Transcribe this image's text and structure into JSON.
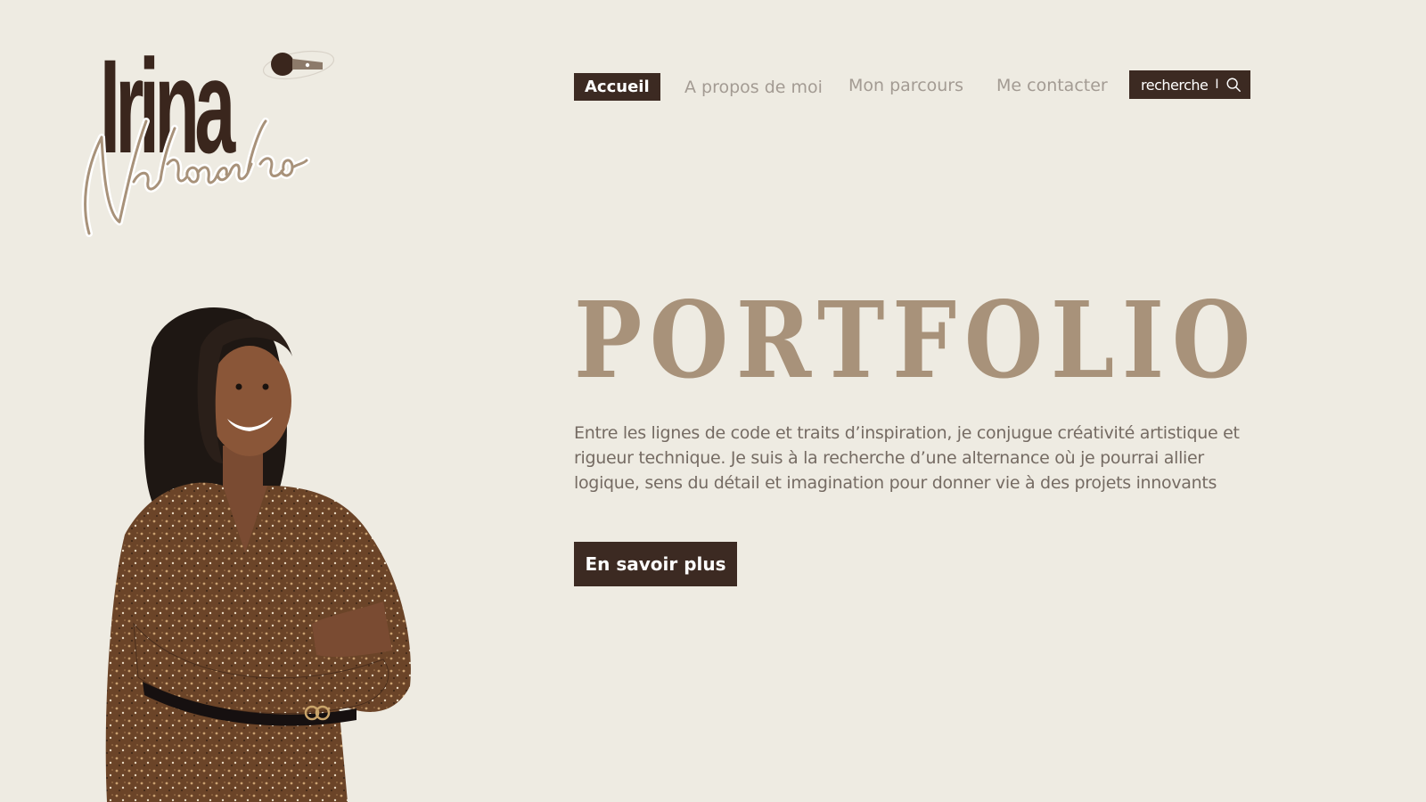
{
  "logo": {
    "first_name": "Irina",
    "last_name": "Nahoaniko",
    "mic_icon": "microphone-icon"
  },
  "nav": {
    "items": [
      {
        "label": "Accueil",
        "active": true
      },
      {
        "label": "A propos de moi",
        "active": false
      },
      {
        "label": "Mon parcours",
        "active": false
      },
      {
        "label": "Me contacter",
        "active": false
      }
    ]
  },
  "search": {
    "label": "recherche",
    "separator": "I",
    "icon": "search-icon"
  },
  "hero": {
    "title": "PORTFOLIO",
    "description": "Entre les lignes de code et traits d’inspiration, je conjugue créativité artistique et rigueur technique. Je suis à la recherche d’une alternance où je pourrai allier logique, sens du détail et imagination pour donner vie à des projets innovants",
    "cta_label": "En savoir plus"
  },
  "colors": {
    "background": "#eeebe2",
    "dark_brown": "#3c2a22",
    "title_tan": "#a8927a",
    "nav_gray": "#a39b93",
    "text_gray": "#756b63"
  }
}
